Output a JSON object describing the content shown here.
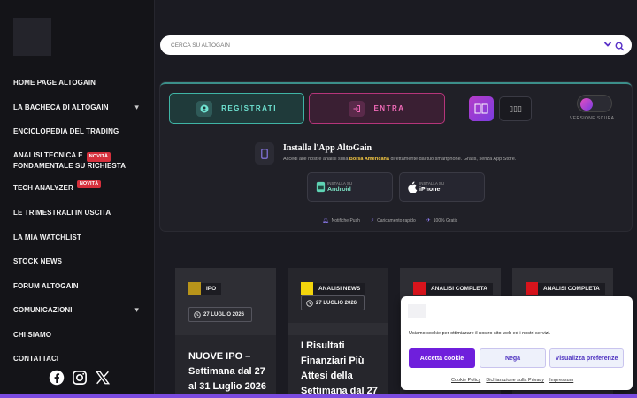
{
  "sidebar": {
    "items": [
      {
        "label": "HOME PAGE ALTOGAIN"
      },
      {
        "label": "LA BACHECA DI ALTOGAIN",
        "chevron": "▾"
      },
      {
        "label": "ENCICLOPEDIA DEL TRADING"
      },
      {
        "label_line1": "ANALISI TECNICA E",
        "label_line2": "FONDAMENTALE SU RICHIESTA",
        "badge": "NOVITÀ"
      },
      {
        "label": "TECH ANALYZER",
        "badge": "NOVITÀ"
      },
      {
        "label": "LE TRIMESTRALI IN USCITA"
      },
      {
        "label": "LA MIA WATCHLIST"
      },
      {
        "label": "STOCK NEWS"
      },
      {
        "label": "FORUM ALTOGAIN"
      },
      {
        "label": "COMUNICAZIONI",
        "chevron": "▾"
      },
      {
        "label": "CHI SIAMO"
      },
      {
        "label": "CONTATTACI"
      }
    ],
    "socials": [
      "facebook-icon",
      "instagram-icon",
      "x-icon"
    ]
  },
  "search": {
    "placeholder": "CERCA SU ALTOGAIN"
  },
  "promo": {
    "register_label": "REGISTRATI",
    "login_label": "ENTRA",
    "layout_b_glyph": "▯▯▯",
    "theme_label": "VERSIONE SCURA",
    "app_title": "Installa l'App AltoGain",
    "app_desc_pre": "Accedi alle nostre analisi sulla ",
    "app_desc_hl": "Borsa Americana",
    "app_desc_post": " direttamente dal tuo smartphone. Gratis, senza App Store.",
    "android_small": "INSTALLA SU",
    "android_big": "Android",
    "iphone_small": "INSTALLA SU",
    "iphone_big": "iPhone",
    "features": [
      "Notifiche Push",
      "Caricamento rapido",
      "100% Gratis"
    ]
  },
  "cards": [
    {
      "tag": "IPO",
      "tag_color": "#b8941a",
      "date": "27 LUGLIO 2026",
      "title": "NUOVE IPO – Settimana dal 27 al 31 Luglio 2026"
    },
    {
      "tag": "ANALISI NEWS",
      "tag_color": "#f2d40c",
      "date": "27 LUGLIO 2026",
      "title": "I Risultati Finanziari Più Attesi della Settimana dal 27"
    },
    {
      "tag": "ANALISI COMPLETA",
      "tag_color": "#d8141c"
    },
    {
      "tag": "ANALISI COMPLETA",
      "tag_color": "#d8141c"
    }
  ],
  "cookie": {
    "text": "Usiamo cookie per ottimizzare il nostro sito web ed i nostri servizi.",
    "accept": "Accetta cookie",
    "deny": "Nega",
    "prefs": "Visualizza preferenze",
    "links": [
      "Cookie Policy",
      "Dichiarazione sulla Privacy",
      "Impressum"
    ]
  }
}
